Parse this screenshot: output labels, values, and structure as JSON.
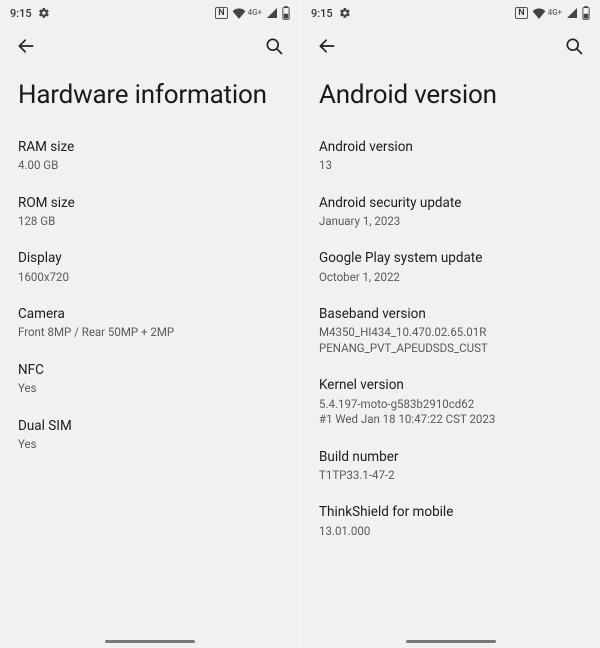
{
  "status": {
    "time": "9:15",
    "nfc": "N",
    "net": "4G+"
  },
  "left": {
    "title": "Hardware information",
    "items": [
      {
        "label": "RAM size",
        "value": "4.00 GB"
      },
      {
        "label": "ROM size",
        "value": "128 GB"
      },
      {
        "label": "Display",
        "value": "1600x720"
      },
      {
        "label": "Camera",
        "value": "Front 8MP / Rear 50MP + 2MP"
      },
      {
        "label": "NFC",
        "value": "Yes"
      },
      {
        "label": "Dual SIM",
        "value": "Yes"
      }
    ]
  },
  "right": {
    "title": "Android version",
    "items": [
      {
        "label": "Android version",
        "value": "13"
      },
      {
        "label": "Android security update",
        "value": "January 1, 2023"
      },
      {
        "label": "Google Play system update",
        "value": "October 1, 2022"
      },
      {
        "label": "Baseband version",
        "value": "M4350_HI434_10.470.02.65.01R\nPENANG_PVT_APEUDSDS_CUST"
      },
      {
        "label": "Kernel version",
        "value": "5.4.197-moto-g583b2910cd62\n#1 Wed Jan 18 10:47:22 CST 2023"
      },
      {
        "label": "Build number",
        "value": "T1TP33.1-47-2"
      },
      {
        "label": "ThinkShield for mobile",
        "value": "13.01.000"
      }
    ]
  }
}
